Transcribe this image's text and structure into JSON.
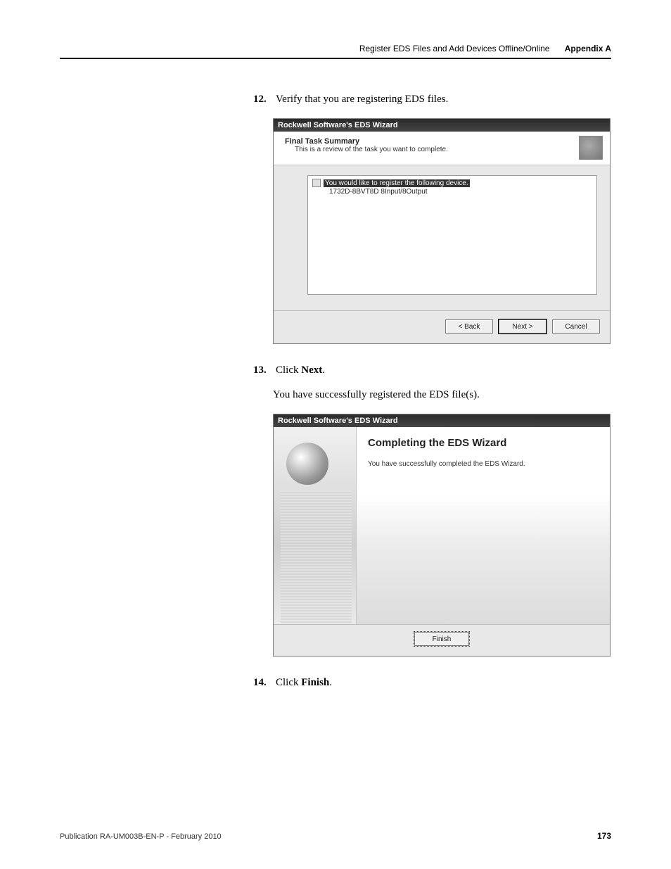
{
  "header": {
    "breadcrumb": "Register EDS Files and Add Devices Offline/Online",
    "appendix": "Appendix A"
  },
  "steps": {
    "s12": {
      "num": "12.",
      "text": "Verify that you are registering EDS files."
    },
    "s13": {
      "num": "13.",
      "pre": "Click ",
      "bold": "Next",
      "post": "."
    },
    "s13_body": "You have successfully registered the EDS file(s).",
    "s14": {
      "num": "14.",
      "pre": "Click ",
      "bold": "Finish",
      "post": "."
    }
  },
  "dlg1": {
    "title": "Rockwell Software's EDS Wizard",
    "head_t1": "Final Task Summary",
    "head_t2": "This is a review of the task you want to complete.",
    "tree_line1": "You would like to register the following device.",
    "tree_line2": "1732D-8BVT8D 8Input/8Output",
    "back": "< Back",
    "next": "Next >",
    "cancel": "Cancel"
  },
  "dlg2": {
    "title": "Rockwell Software's EDS Wizard",
    "big": "Completing the EDS Wizard",
    "small": "You have successfully completed the EDS Wizard.",
    "finish": "Finish"
  },
  "footer": {
    "pub": "Publication RA-UM003B-EN-P - February 2010",
    "page": "173"
  }
}
